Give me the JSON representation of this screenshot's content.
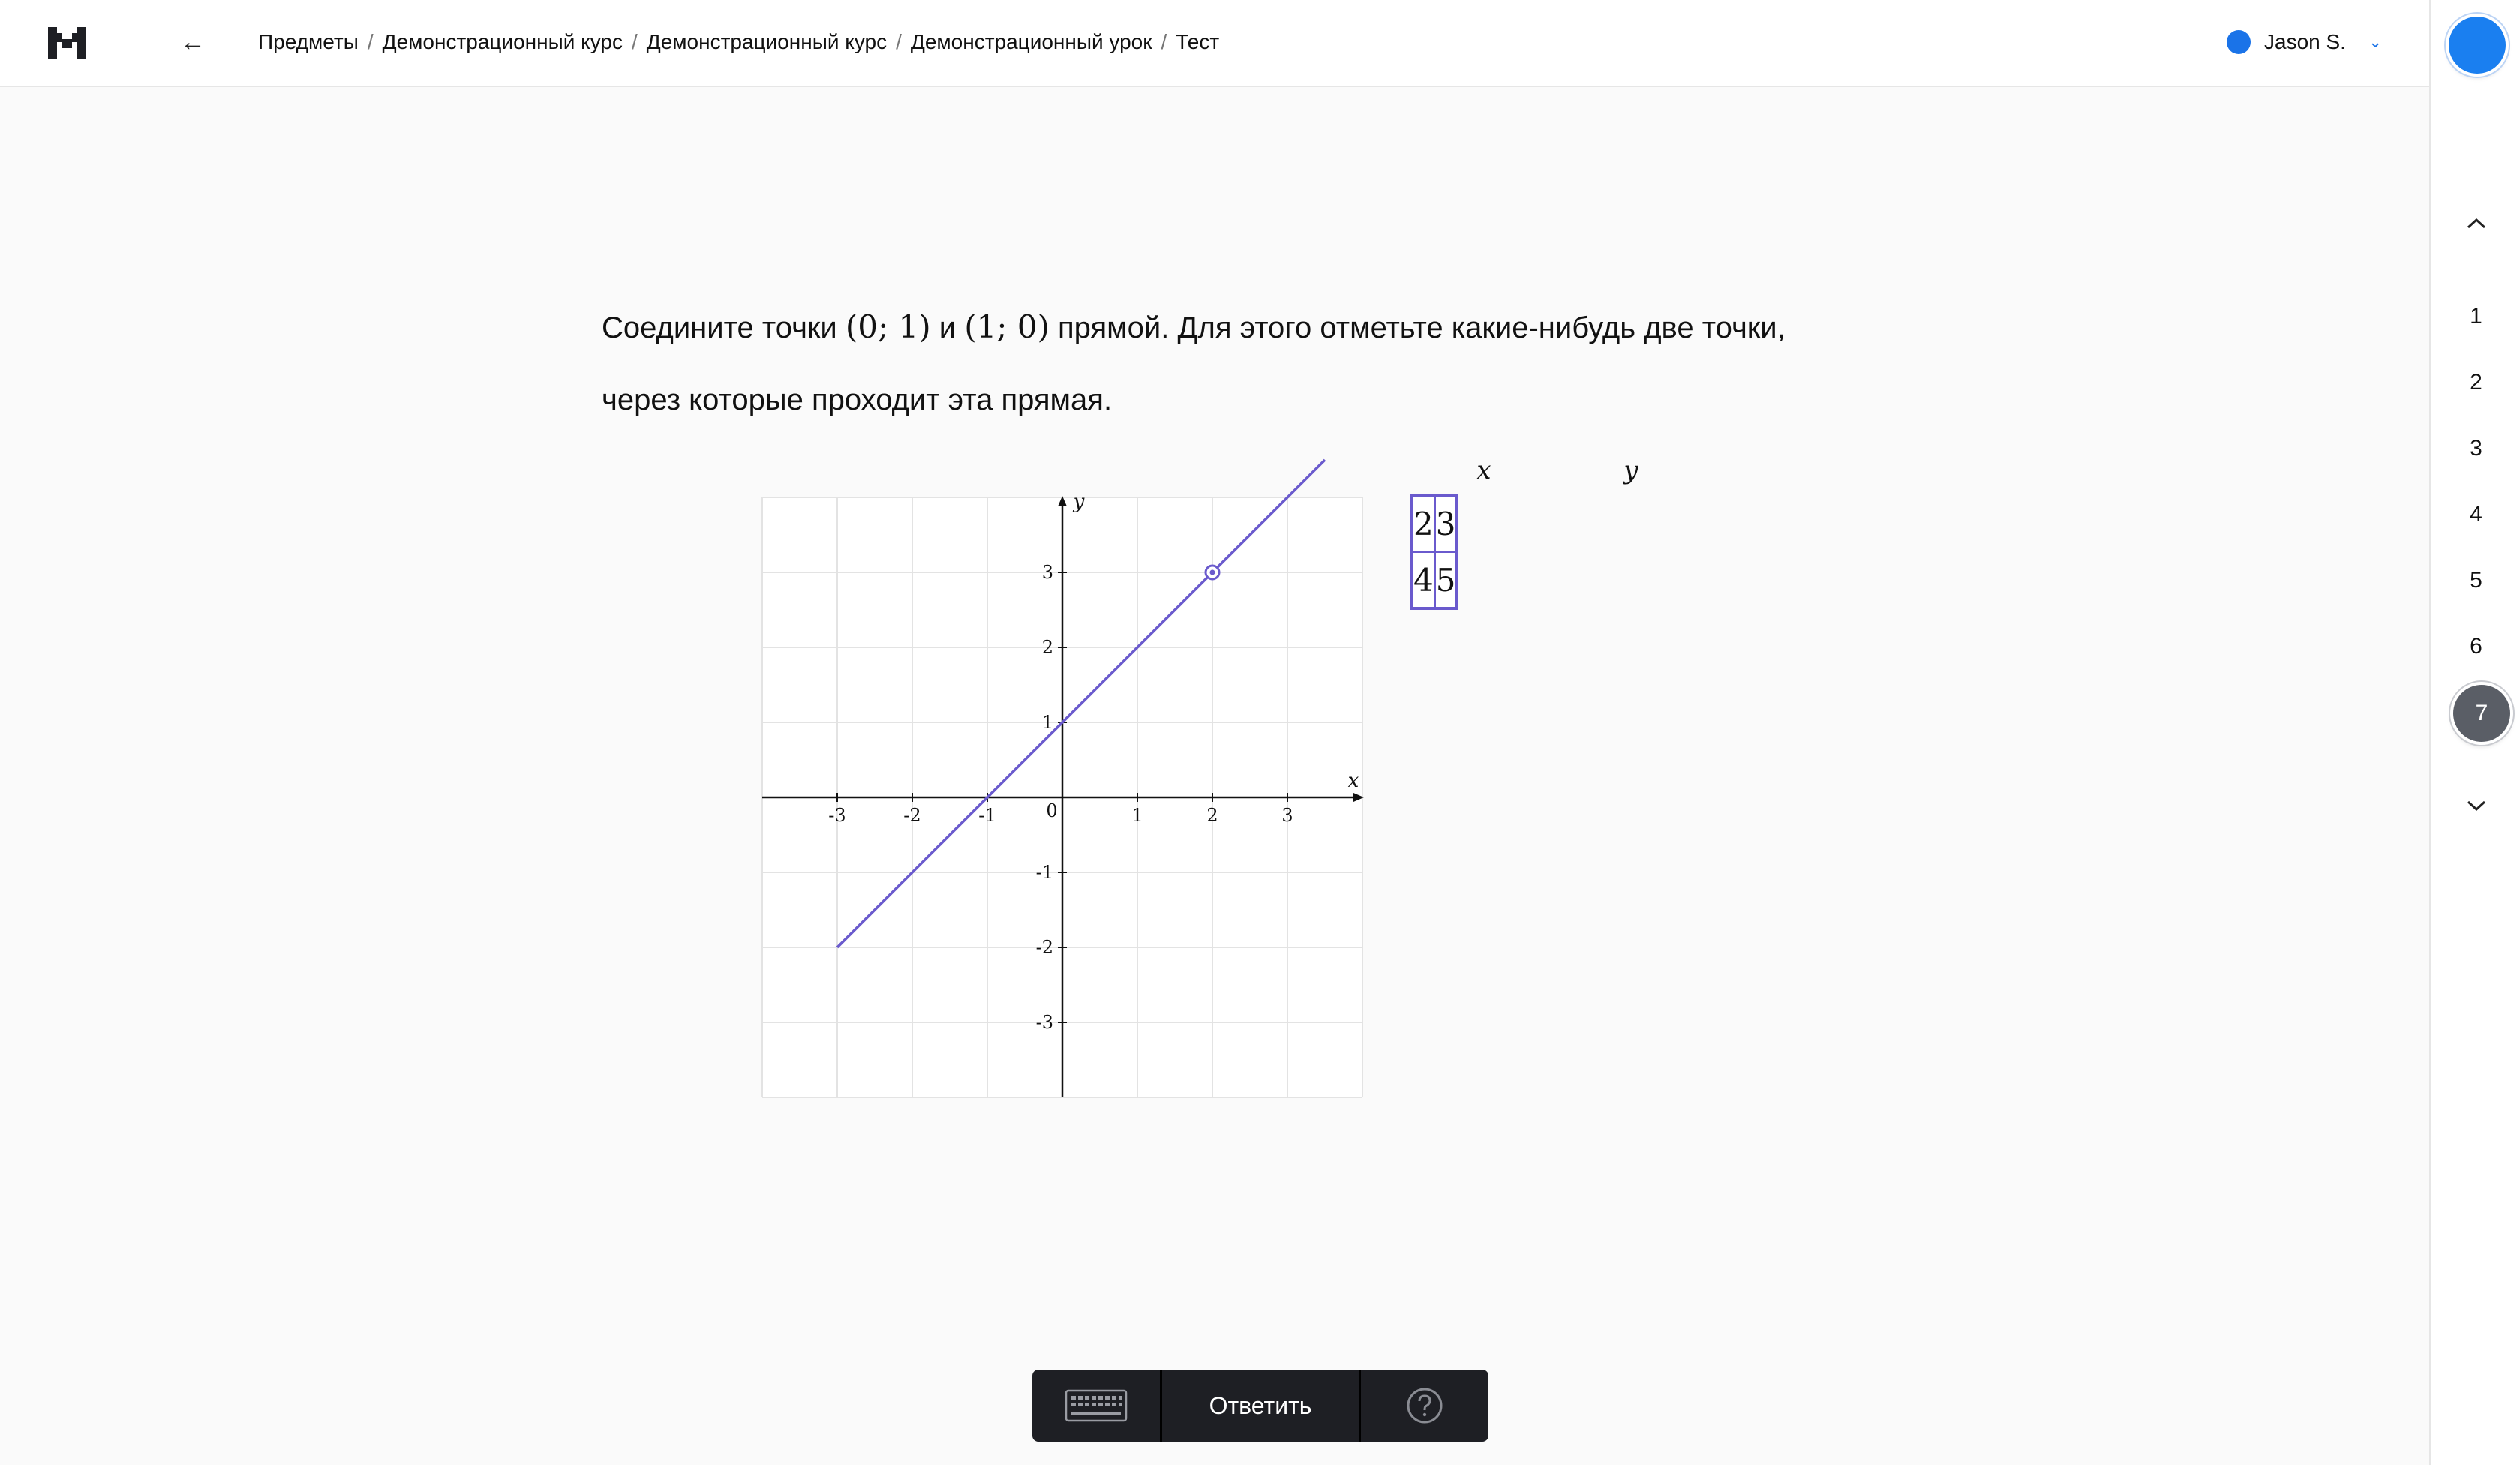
{
  "header": {
    "breadcrumb": [
      "Предметы",
      "Демонстрационный курс",
      "Демонстрационный курс",
      "Демонстрационный урок",
      "Тест"
    ],
    "separator": "/",
    "back_icon": "arrow-left-icon",
    "user_name": "Jason S.",
    "user_color": "#1a73e8",
    "accent_color": "#6a5acd"
  },
  "sidebar": {
    "questions": [
      "1",
      "2",
      "3",
      "4",
      "5",
      "6",
      "7"
    ],
    "active_question": "7",
    "up_icon": "chevron-up-icon",
    "down_icon": "chevron-down-icon"
  },
  "question": {
    "text_1": "Соедините точки ",
    "point_a": "(0; 1)",
    "text_2": " и ",
    "point_b": "(1; 0)",
    "text_3": " прямой. Для этого отметьте какие-нибудь две точки,",
    "text_4": "через которые проходит эта прямая."
  },
  "graph": {
    "x_label": "x",
    "y_label": "y",
    "x_ticks": [
      "-3",
      "-2",
      "-1",
      "0",
      "1",
      "2",
      "3"
    ],
    "y_ticks": [
      "3",
      "2",
      "1",
      "-1",
      "-2",
      "-3"
    ],
    "range": [
      -4,
      4
    ],
    "line": {
      "slope": 1,
      "intercept": 1
    },
    "marked_point": [
      2,
      3
    ],
    "line_color": "#6a5acd"
  },
  "table": {
    "headers": [
      "x",
      "y"
    ],
    "rows": [
      [
        "2",
        "3"
      ],
      [
        "4",
        "5"
      ]
    ]
  },
  "toolbar": {
    "keyboard_icon": "keyboard-icon",
    "answer_label": "Ответить",
    "help_icon": "help-icon"
  }
}
